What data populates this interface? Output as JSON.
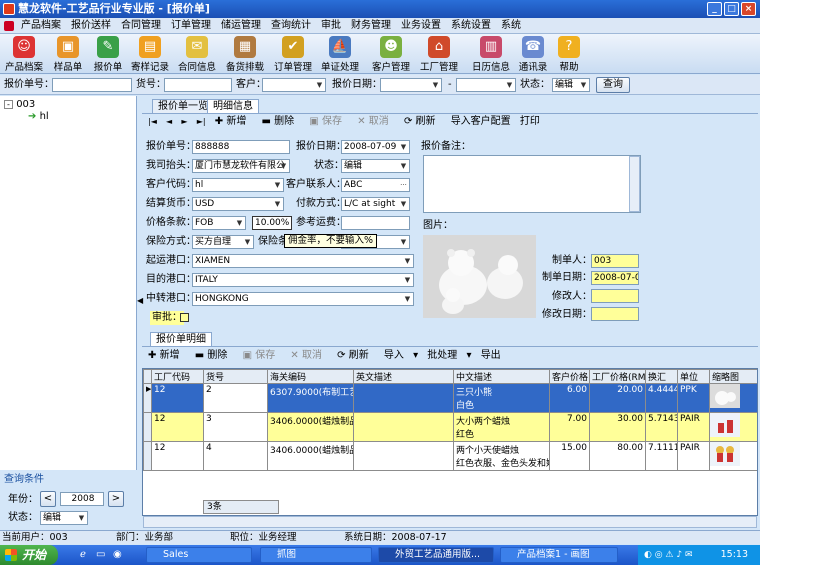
{
  "window": {
    "title": "慧龙软件-工艺品行业专业版  - [报价单]"
  },
  "menu": [
    "产品档案",
    "报价送样",
    "合同管理",
    "订单管理",
    "储运管理",
    "查询统计",
    "审批",
    "财务管理",
    "业务设置",
    "系统设置",
    "系统"
  ],
  "toolbar": [
    "产品档案",
    "样品单",
    "报价单",
    "寄样记录",
    "合同信息",
    "备货排载",
    "订单管理",
    "单证处理",
    "客户管理",
    "工厂管理",
    "日历信息",
    "通讯录",
    "帮助"
  ],
  "search": {
    "quote_no_label": "报价单号：",
    "quote_no": "",
    "item_no_label": "货号：",
    "item_no": "",
    "customer_label": "客户：",
    "customer": "",
    "date_label": "报价日期：",
    "date_from": "",
    "dash": "-",
    "date_to": "",
    "status_label": "状态：",
    "status": "编辑",
    "query_button": "查询"
  },
  "tree": {
    "root": "003",
    "child": "hl"
  },
  "left_cond": {
    "title": "查询条件",
    "year_label": "年份：",
    "year": "2008",
    "prev": "<",
    "next": ">",
    "status_label": "状态：",
    "status": "编辑"
  },
  "tabs": {
    "list": "报价单一览",
    "detail": "明细信息"
  },
  "detail_toolbar": {
    "first": "|◄",
    "prev": "◄",
    "next": "►",
    "last": "►|",
    "add": "新增",
    "delete": "删除",
    "save": "保存",
    "cancel": "取消",
    "refresh": "刷新",
    "import_config": "导入客户配置",
    "print": "打印"
  },
  "form": {
    "quote_no_label": "报价单号：",
    "quote_no": "888888",
    "quote_date_label": "报价日期：",
    "quote_date": "2008-07-09",
    "company_label": "我司抬头：",
    "company": "厦门市慧龙软件有限公",
    "status_label": "状态：",
    "status": "编辑",
    "customer_code_label": "客户代码：",
    "customer_code": "hl",
    "contact_label": "客户联系人：",
    "contact": "ABC",
    "currency_label": "结算货币：",
    "currency": "USD",
    "payment_label": "付款方式：",
    "payment": "L/C at sight",
    "price_term_label": "价格条款：",
    "price_term": "FOB",
    "rate": "10.00%",
    "freight_label": "参考运费：",
    "freight": "",
    "insurance_label": "保险方式：",
    "insurance": "买方自理",
    "insurance_type_label": "保险条",
    "tooltip": "佣金率，不要输入%",
    "port_from_label": "起运港口：",
    "port_from": "XIAMEN",
    "port_to_label": "目的港口：",
    "port_to": "ITALY",
    "port_transit_label": "中转港口：",
    "port_transit": "HONGKONG",
    "approve_label": "审批：",
    "remark_label": "报价备注：",
    "picture_label": "图片：",
    "maker_label": "制单人：",
    "maker": "003",
    "make_date_label": "制单日期：",
    "make_date": "2008-07-09",
    "modifier_label": "修改人：",
    "modifier": "",
    "modify_date_label": "修改日期：",
    "modify_date": ""
  },
  "detail_tab": "报价单明细",
  "grid_toolbar": {
    "add": "新增",
    "delete": "删除",
    "save": "保存",
    "cancel": "取消",
    "refresh": "刷新",
    "import": "导入",
    "batch": "批处理",
    "export": "导出"
  },
  "grid": {
    "headers": [
      "工厂代码",
      "货号",
      "海关编码",
      "英文描述",
      "中文描述",
      "客户价格",
      "工厂价格(RMB)",
      "换汇",
      "单位",
      "缩略图"
    ],
    "rows": [
      {
        "factory": "12",
        "item": "2",
        "hs": "6307.9000(布制工艺品",
        "en": "",
        "cn1": "三只小熊",
        "cn2": "白色",
        "price": "6.00",
        "fprice": "20.00",
        "rate": "4.4444",
        "unit": "PPK"
      },
      {
        "factory": "12",
        "item": "3",
        "hs": "3406.0000(蜡烛制品)",
        "en": "",
        "cn1": "大小两个蜡烛",
        "cn2": "红色",
        "price": "7.00",
        "fprice": "30.00",
        "rate": "5.7143",
        "unit": "PAIR"
      },
      {
        "factory": "12",
        "item": "4",
        "hs": "3406.0000(蜡烛制品)",
        "en": "",
        "cn1": "两个小天使蜡烛",
        "cn2": "红色衣服、金色头发和姚",
        "price": "15.00",
        "fprice": "80.00",
        "rate": "7.1111",
        "unit": "PAIR"
      }
    ],
    "count": "3条"
  },
  "status": {
    "user": "当前用户：003",
    "dept": "部门：业务部",
    "position": "职位：业务经理",
    "sysdate": "系统日期：2008-07-17"
  },
  "taskbar": {
    "start": "开始",
    "tasks": [
      "Sales",
      "抓图",
      "外贸工艺品通用版...",
      "产品档案1 - 画图"
    ],
    "clock": "15:13"
  }
}
